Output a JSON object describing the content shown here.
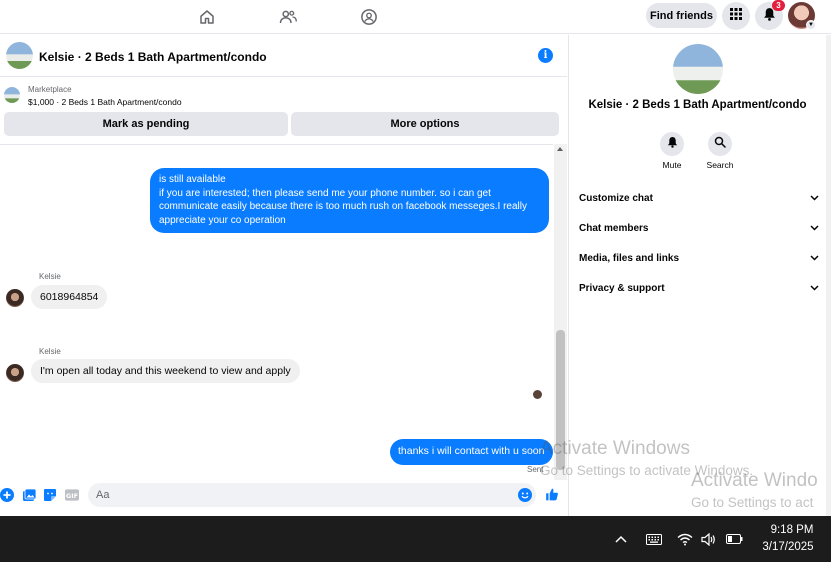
{
  "topnav": {
    "find_friends_label": "Find friends",
    "notification_count": "3"
  },
  "chat": {
    "title": "Kelsie · 2 Beds 1 Bath Apartment/condo",
    "info_glyph": "i"
  },
  "marketplace": {
    "label": "Marketplace",
    "listing": "$1,000 · 2 Beds 1 Bath Apartment/condo",
    "mark_pending_label": "Mark as pending",
    "more_options_label": "More options"
  },
  "messages": {
    "outgoing_1_line1": "is still available",
    "outgoing_1_line2": "if you are interested; then please send me your phone number. so i can get communicate easily because there is too much rush on facebook messeges.I really appreciate your co operation",
    "sender_1": "Kelsie",
    "incoming_1": "6018964854",
    "sender_2": "Kelsie",
    "incoming_2": "I'm open all today and this weekend to view and apply",
    "outgoing_2": "thanks i will contact with u soon",
    "sent_label": "Sent"
  },
  "composer": {
    "placeholder": "Aa"
  },
  "right_panel": {
    "title": "Kelsie · 2 Beds 1 Bath Apartment/condo",
    "mute_label": "Mute",
    "search_label": "Search",
    "sections": [
      "Customize chat",
      "Chat members",
      "Media, files and links",
      "Privacy & support"
    ]
  },
  "watermark": {
    "title": "Activate Windows",
    "subtitle": "Go to Settings to activate Windows.",
    "title_2": "Activate Windo",
    "subtitle_2": "Go to Settings to act"
  },
  "taskbar": {
    "time": "9:18 PM",
    "date": "3/17/2025"
  },
  "colors": {
    "accent": "#0a7cff",
    "badge": "#e41e3f",
    "taskbar": "#1c1c1c"
  },
  "icons": [
    "home-icon",
    "friends-icon",
    "groups-icon",
    "menu-grid-icon",
    "bell-icon",
    "info-icon",
    "bell-mute-icon",
    "search-icon",
    "plus-icon",
    "image-icon",
    "sticker-icon",
    "gif-icon",
    "emoji-icon",
    "like-icon",
    "chevron-up-icon",
    "keyboard-icon",
    "wifi-icon",
    "volume-icon",
    "battery-icon"
  ]
}
